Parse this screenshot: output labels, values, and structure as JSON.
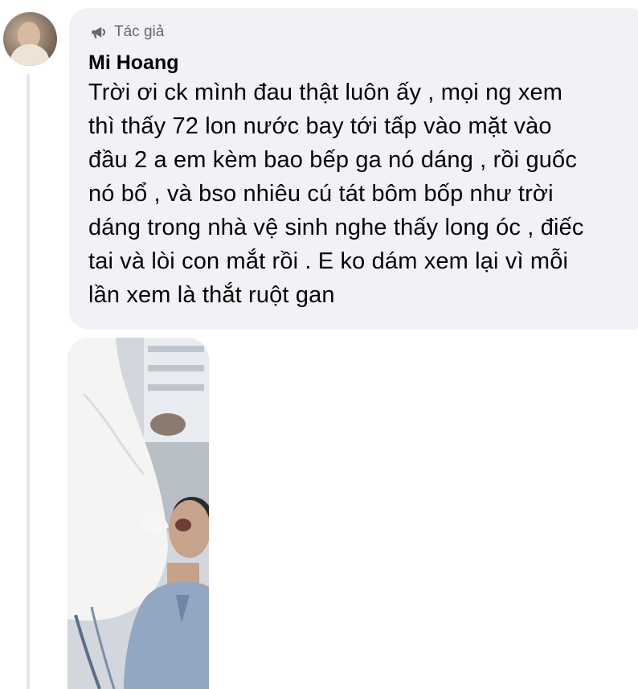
{
  "comment": {
    "author_badge": {
      "icon": "megaphone-icon",
      "label": "Tác giả"
    },
    "author_name": "Mi Hoang",
    "text_lines": [
      "Trời ơi ck mình đau thật luôn ấy , mọi ng xem",
      "thì thấy 72 lon nước bay tới tấp vào mặt vào",
      "đầu 2 a em kèm bao bếp ga nó dáng , rồi guốc",
      "nó bổ , và bso nhiêu cú tát bôm bốp như trời",
      "dáng trong nhà vệ sinh nghe thấy long óc , điếc",
      "tai và lòi con mắt rồi . E ko dám xem lại vì mỗi",
      "lần xem là thắt ruột gan"
    ]
  },
  "colors": {
    "bubble_background": "#f0f2f5",
    "badge_text": "#65676b",
    "primary_text": "#050505",
    "thread_line": "#e4e6eb"
  }
}
